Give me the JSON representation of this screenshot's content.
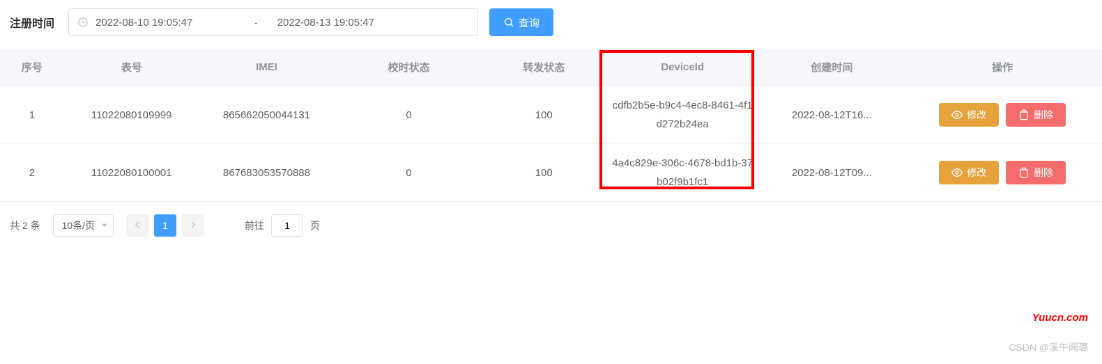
{
  "filter": {
    "label": "注册时间",
    "start": "2022-08-10 19:05:47",
    "end": "2022-08-13 19:05:47",
    "separator": "-",
    "search_label": "查询"
  },
  "table": {
    "headers": {
      "seq": "序号",
      "meter": "表号",
      "imei": "IMEI",
      "cal_status": "校时状态",
      "fwd_status": "转发状态",
      "device_id": "DeviceId",
      "created": "创建时间",
      "ops": "操作"
    },
    "rows": [
      {
        "seq": "1",
        "meter": "11022080109999",
        "imei": "865662050044131",
        "cal_status": "0",
        "fwd_status": "100",
        "device_id": "cdfb2b5e-b9c4-4ec8-8461-4f1d272b24ea",
        "created": "2022-08-12T16..."
      },
      {
        "seq": "2",
        "meter": "11022080100001",
        "imei": "867683053570888",
        "cal_status": "0",
        "fwd_status": "100",
        "device_id": "4a4c829e-306c-4678-bd1b-37b02f9b1fc1",
        "created": "2022-08-12T09..."
      }
    ],
    "actions": {
      "edit": "修改",
      "delete": "删除"
    }
  },
  "pagination": {
    "total_text": "共 2 条",
    "page_size": "10条/页",
    "current": "1",
    "jump_prefix": "前往",
    "jump_value": "1",
    "jump_suffix": "页"
  },
  "watermark": {
    "site": "Yuucn.com",
    "csdn": "CSDN @溪午闻璐"
  }
}
